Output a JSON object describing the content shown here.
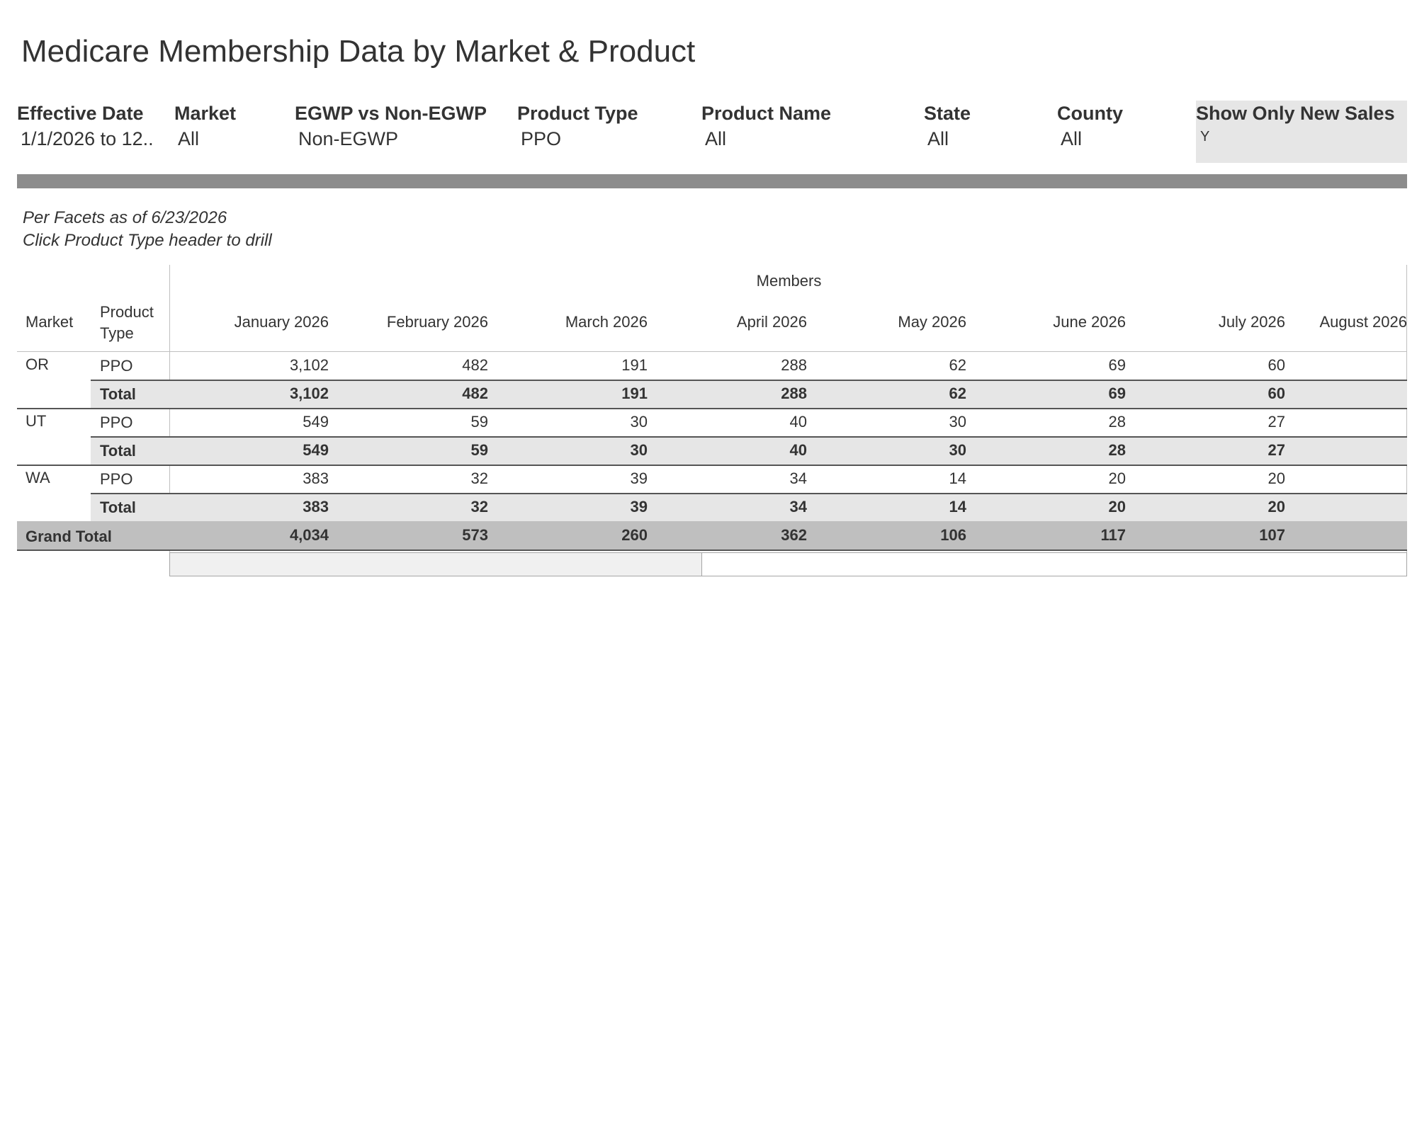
{
  "page_title": "Medicare Membership Data by Market & Product",
  "filters": [
    {
      "label": "Effective Date",
      "value": "1/1/2026 to 12.."
    },
    {
      "label": "Market",
      "value": "All"
    },
    {
      "label": "EGWP vs Non-EGWP",
      "value": "Non-EGWP"
    },
    {
      "label": "Product Type",
      "value": "PPO"
    },
    {
      "label": "Product Name",
      "value": "All"
    },
    {
      "label": "State",
      "value": "All"
    },
    {
      "label": "County",
      "value": "All"
    },
    {
      "label": "Show Only New Sales",
      "value": "Y"
    }
  ],
  "notes": {
    "line1": "Per Facets as of 6/23/2026",
    "line2": "Click Product Type header to drill"
  },
  "table": {
    "measure_header": "Members",
    "row_headers": {
      "market": "Market",
      "product_type_line1": "Product",
      "product_type_line2": "Type"
    },
    "months": [
      "January 2026",
      "February 2026",
      "March 2026",
      "April 2026",
      "May 2026",
      "June 2026",
      "July 2026",
      "August 2026"
    ],
    "markets": [
      {
        "name": "OR",
        "product": "PPO",
        "values": [
          "3,102",
          "482",
          "191",
          "288",
          "62",
          "69",
          "60"
        ],
        "total_label": "Total",
        "totals": [
          "3,102",
          "482",
          "191",
          "288",
          "62",
          "69",
          "60"
        ]
      },
      {
        "name": "UT",
        "product": "PPO",
        "values": [
          "549",
          "59",
          "30",
          "40",
          "30",
          "28",
          "27"
        ],
        "total_label": "Total",
        "totals": [
          "549",
          "59",
          "30",
          "40",
          "30",
          "28",
          "27"
        ]
      },
      {
        "name": "WA",
        "product": "PPO",
        "values": [
          "383",
          "32",
          "39",
          "34",
          "14",
          "20",
          "20"
        ],
        "total_label": "Total",
        "totals": [
          "383",
          "32",
          "39",
          "34",
          "14",
          "20",
          "20"
        ]
      }
    ],
    "grand_total": {
      "label": "Grand Total",
      "values": [
        "4,034",
        "573",
        "260",
        "362",
        "106",
        "117",
        "107"
      ]
    }
  },
  "colors": {
    "total_band": "#e6e6e6",
    "grand_total_band": "#bfbfbf",
    "divider": "#8c8c8c"
  }
}
